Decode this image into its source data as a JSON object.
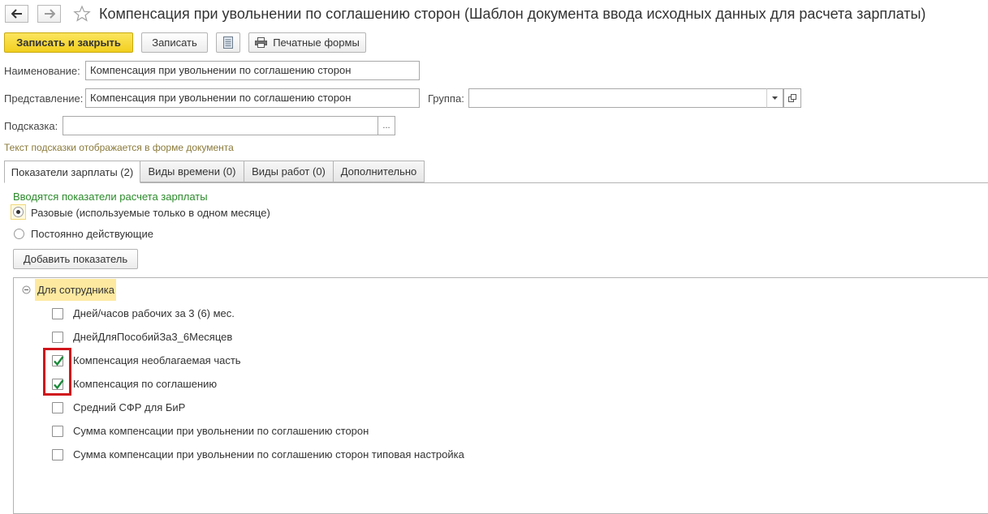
{
  "window": {
    "title": "Компенсация при увольнении по соглашению сторон (Шаблон документа ввода исходных данных для расчета зарплаты)",
    "back_icon": "arrow-left-icon",
    "forward_icon": "arrow-right-icon",
    "favorite_icon": "star-icon"
  },
  "toolbar": {
    "save_close_label": "Записать и закрыть",
    "save_label": "Записать",
    "report_icon": "list-document-icon",
    "print_icon": "printer-icon",
    "print_label": "Печатные формы"
  },
  "form": {
    "name_label": "Наименование:",
    "name_value": "Компенсация при увольнении по соглашению сторон",
    "presentation_label": "Представление:",
    "presentation_value": "Компенсация при увольнении по соглашению сторон",
    "group_label": "Группа:",
    "group_value": "",
    "hint_label": "Подсказка:",
    "hint_value": "",
    "hint_select_label": "...",
    "hint_note": "Текст подсказки отображается в форме документа"
  },
  "tabs": [
    {
      "label": "Показатели зарплаты (2)",
      "active": true
    },
    {
      "label": "Виды времени (0)",
      "active": false
    },
    {
      "label": "Виды работ (0)",
      "active": false
    },
    {
      "label": "Дополнительно",
      "active": false
    }
  ],
  "indicators": {
    "heading": "Вводятся показатели расчета зарплаты",
    "options": [
      {
        "label": "Разовые (используемые только в одном месяце)",
        "selected": true
      },
      {
        "label": "Постоянно действующие",
        "selected": false
      }
    ],
    "add_button_label": "Добавить показатель",
    "tree": {
      "group_label": "Для сотрудника",
      "items": [
        {
          "label": "Дней/часов рабочих за 3 (6) мес.",
          "checked": false
        },
        {
          "label": "ДнейДляПособийЗа3_6Месяцев",
          "checked": false
        },
        {
          "label": "Компенсация необлагаемая часть",
          "checked": true
        },
        {
          "label": "Компенсация по соглашению",
          "checked": true
        },
        {
          "label": "Средний СФР для БиР",
          "checked": false
        },
        {
          "label": "Сумма компенсации при увольнении по соглашению сторон",
          "checked": false
        },
        {
          "label": "Сумма компенсации при увольнении по соглашению сторон типовая настройка",
          "checked": false
        }
      ]
    }
  },
  "colors": {
    "primary_button": "#f2cf1f",
    "heading_green": "#2a8a2a",
    "hint_note": "#8a7a3a",
    "group_highlight": "#fde9a0",
    "check_green": "#1a8a3a",
    "highlight_frame": "#d0141b"
  }
}
